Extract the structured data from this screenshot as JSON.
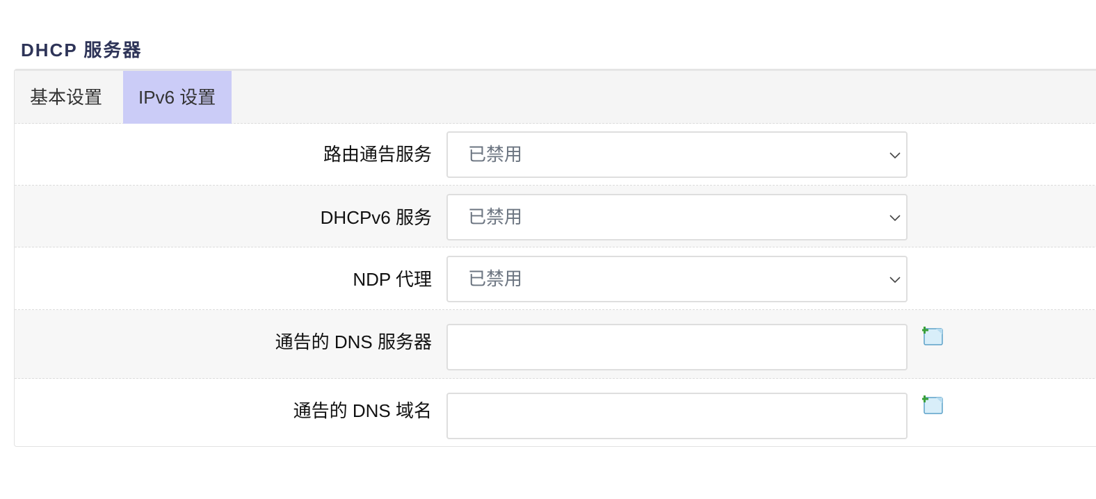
{
  "section": {
    "title": "DHCP 服务器"
  },
  "tabs": [
    {
      "label": "基本设置",
      "active": false
    },
    {
      "label": "IPv6 设置",
      "active": true
    }
  ],
  "fields": {
    "ra_service": {
      "label": "路由通告服务",
      "value": "已禁用"
    },
    "dhcpv6_service": {
      "label": "DHCPv6 服务",
      "value": "已禁用"
    },
    "ndp_proxy": {
      "label": "NDP 代理",
      "value": "已禁用"
    },
    "dns_servers": {
      "label": "通告的 DNS 服务器",
      "value": ""
    },
    "dns_domains": {
      "label": "通告的 DNS 域名",
      "value": ""
    }
  },
  "colors": {
    "title": "#2e3458",
    "active_tab": "#cbccf7",
    "select_text": "#6b7480"
  },
  "icons": {
    "dropdown": "chevron-down-icon",
    "add": "add-entry-icon"
  }
}
